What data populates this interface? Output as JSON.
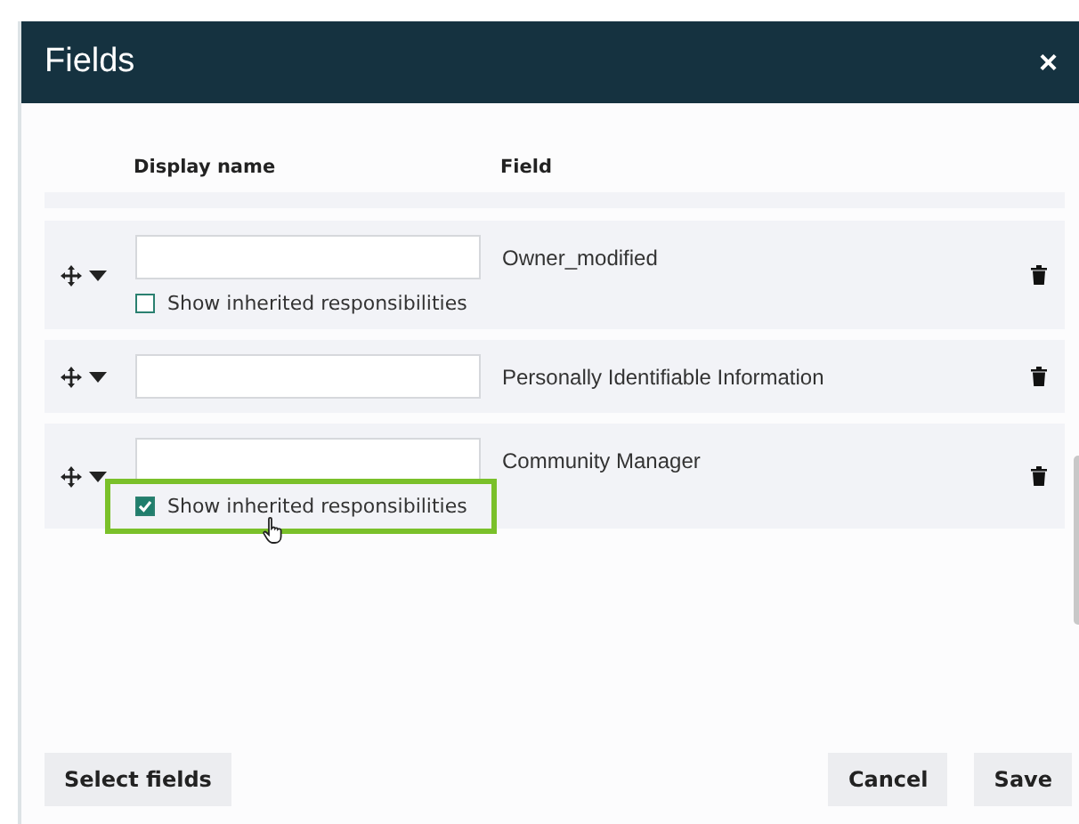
{
  "dialog": {
    "title": "Fields",
    "close": "×"
  },
  "columns": [
    "Display name",
    "Field"
  ],
  "rows": [
    {
      "display_name": "",
      "field": "Owner_modified",
      "checkbox": {
        "label": "Show inherited responsibilities",
        "checked": false,
        "highlighted": false
      }
    },
    {
      "display_name": "",
      "field": "Personally Identifiable Information"
    },
    {
      "display_name": "",
      "field": "Community Manager",
      "checkbox": {
        "label": "Show inherited responsibilities",
        "checked": true,
        "highlighted": true
      }
    }
  ],
  "buttons": {
    "left": [
      "Select fields"
    ],
    "right": [
      "Cancel",
      "Save"
    ]
  }
}
